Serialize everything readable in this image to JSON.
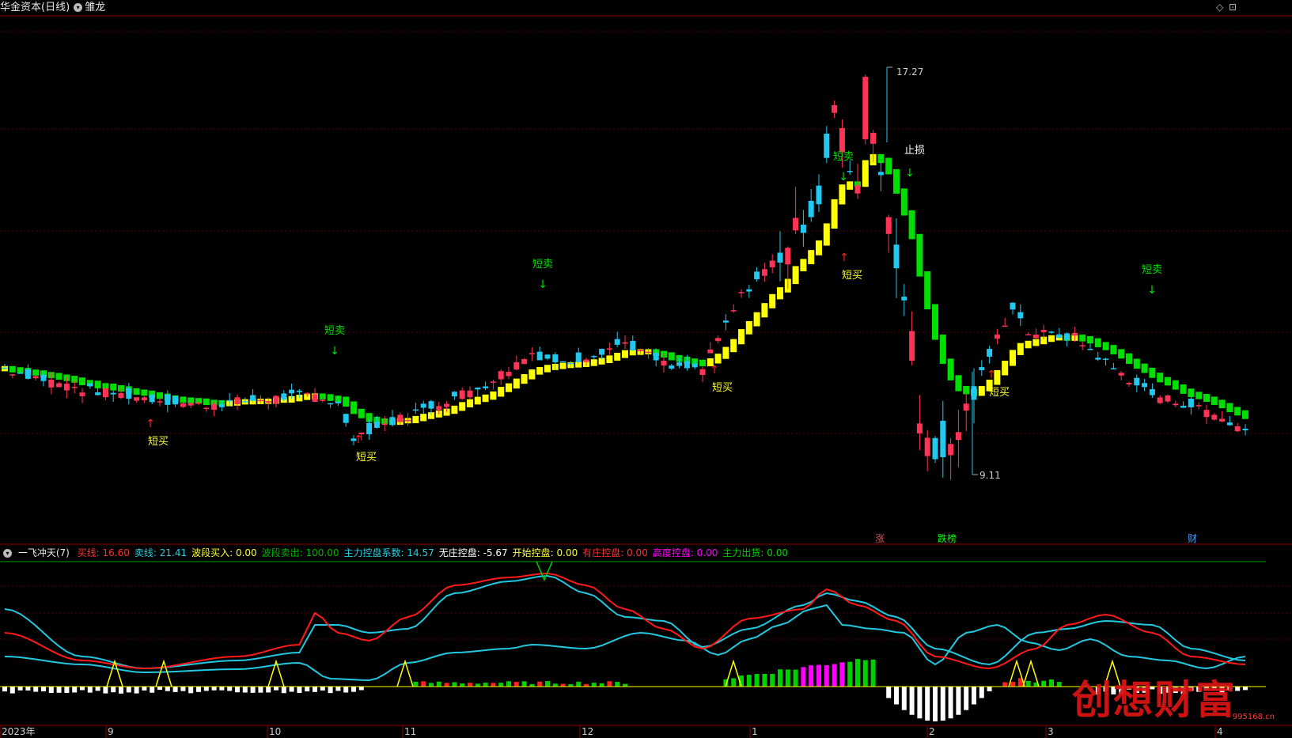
{
  "header": {
    "title": "华金资本(日线)",
    "indicator_name": "雏龙"
  },
  "indicator_bar": {
    "name": "一飞冲天(7)",
    "items": [
      {
        "label": "买线: 16.60",
        "color": "#ff3030"
      },
      {
        "label": "卖线: 21.41",
        "color": "#22d0e0"
      },
      {
        "label": "波段买入: 0.00",
        "color": "#ffff33"
      },
      {
        "label": "波段卖出: 100.00",
        "color": "#00b000"
      },
      {
        "label": "主力控盘系数: 14.57",
        "color": "#22d0e0"
      },
      {
        "label": "无庄控盘: -5.67",
        "color": "#ffffff"
      },
      {
        "label": "开始控盘: 0.00",
        "color": "#ffff33"
      },
      {
        "label": "有庄控盘: 0.00",
        "color": "#ff3030"
      },
      {
        "label": "高度控盘: 0.00",
        "color": "#ff00ff"
      },
      {
        "label": "主力出货: 0.00",
        "color": "#00d000"
      }
    ]
  },
  "chart_data": [
    {
      "type": "candlestick",
      "labels": {
        "high": "17.27",
        "low": "9.11",
        "stop": "止损",
        "short_sell": "短卖",
        "short_buy": "短买"
      },
      "markers": [
        {
          "kind": "短买",
          "x": 190
        },
        {
          "kind": "短卖",
          "x": 405
        },
        {
          "kind": "短买",
          "x": 453
        },
        {
          "kind": "短卖",
          "x": 668
        },
        {
          "kind": "短买",
          "x": 903
        },
        {
          "kind": "短卖",
          "x": 1048
        },
        {
          "kind": "短买",
          "x": 1067
        },
        {
          "kind": "短买",
          "x": 1253
        },
        {
          "kind": "短卖",
          "x": 1438
        }
      ],
      "event_tags": [
        {
          "text": "涨",
          "color": "#ff4040"
        },
        {
          "text": "跌榜",
          "color": "#00ff00"
        },
        {
          "text": "财",
          "color": "#40a0ff"
        }
      ]
    },
    {
      "type": "line",
      "x_labels": [
        "2023年",
        "9",
        "10",
        "11",
        "12",
        "1",
        "2",
        "3",
        "4"
      ],
      "series": [
        {
          "name": "买线",
          "color": "#ff2020"
        },
        {
          "name": "卖线",
          "color": "#22d0e0"
        },
        {
          "name": "主力控盘系数",
          "color": "#22d0e0"
        }
      ]
    }
  ],
  "watermark": {
    "text": "创想财富",
    "url": "995168.cn"
  }
}
